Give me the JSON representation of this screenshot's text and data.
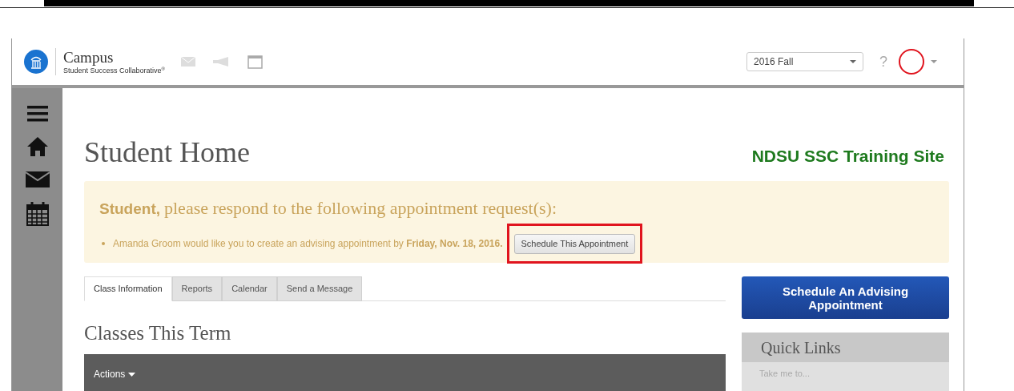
{
  "header": {
    "brand": "Campus",
    "tagline": "Student Success Collaborative",
    "tagline_mark": "®",
    "term_select": {
      "value": "2016 Fall"
    },
    "help": "?"
  },
  "sidebar": {
    "items": [
      {
        "kind": "menu"
      },
      {
        "kind": "home"
      },
      {
        "kind": "mail"
      },
      {
        "kind": "calendar"
      }
    ]
  },
  "page": {
    "title": "Student Home",
    "site_label": "NDSU SSC Training Site"
  },
  "alert": {
    "heading_name": "Student,",
    "heading_text": "please respond to the following appointment request(s):",
    "items": [
      {
        "text": "Amanda Groom would like you to create an advising appointment by **Friday, Nov. 18, 2016.**",
        "button": "Schedule This Appointment",
        "highlighted": true
      }
    ]
  },
  "tabs": [
    {
      "label": "Class Information",
      "selected": true
    },
    {
      "label": "Reports",
      "selected": false
    },
    {
      "label": "Calendar",
      "selected": false
    },
    {
      "label": "Send a Message",
      "selected": false
    }
  ],
  "classes": {
    "title": "Classes This Term",
    "actions": "Actions"
  },
  "advising_button": "Schedule An Advising Appointment",
  "quick_links": {
    "title": "Quick Links",
    "placeholder": "Take me to..."
  }
}
